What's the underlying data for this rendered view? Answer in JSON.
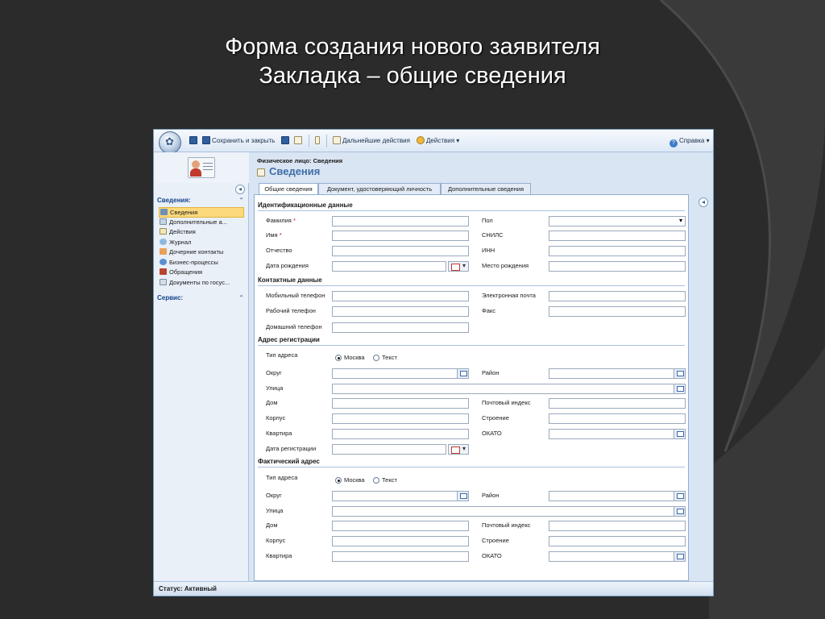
{
  "slide": {
    "title_line1": "Форма создания нового заявителя",
    "title_line2": "Закладка – общие сведения"
  },
  "toolbar": {
    "save_close": "Сохранить и закрыть",
    "further_actions": "Дальнейшие действия",
    "actions": "Действия ▾",
    "help": "Справка ▾"
  },
  "nav": {
    "section_info": "Сведения:",
    "section_service": "Сервис:",
    "items": [
      {
        "label": "Сведения",
        "icon": "info-icon",
        "selected": true
      },
      {
        "label": "Дополнительные а...",
        "icon": "address-icon"
      },
      {
        "label": "Действия",
        "icon": "actions-icon"
      },
      {
        "label": "Журнал",
        "icon": "journal-icon"
      },
      {
        "label": "Дочерние контакты",
        "icon": "contacts-icon"
      },
      {
        "label": "Бизнес-процессы",
        "icon": "process-icon"
      },
      {
        "label": "Обращения",
        "icon": "requests-icon"
      },
      {
        "label": "Документы по госус...",
        "icon": "documents-icon"
      }
    ]
  },
  "header": {
    "entity": "Физическое лицо: Сведения",
    "title": "Сведения"
  },
  "tabs": [
    {
      "label": "Общие сведения",
      "active": true
    },
    {
      "label": "Документ, удостоверяющий личность"
    },
    {
      "label": "Дополнительные сведения"
    }
  ],
  "form": {
    "sec_ident": "Идентификационные данные",
    "lastname": "Фамилия",
    "firstname": "Имя",
    "patronymic": "Отчество",
    "birthdate": "Дата рождения",
    "gender": "Пол",
    "snils": "СНИЛС",
    "inn": "ИНН",
    "birthplace": "Место рождения",
    "sec_contacts": "Контактные данные",
    "mobile": "Мобильный телефон",
    "work_phone": "Рабочий телефон",
    "home_phone": "Домашний телефон",
    "email": "Электронная почта",
    "fax": "Факс",
    "sec_reg": "Адрес регистрации",
    "sec_fact": "Фактический адрес",
    "addr_type": "Тип адреса",
    "opt_moscow": "Москва",
    "opt_text": "Текст",
    "district": "Округ",
    "region": "Район",
    "street": "Улица",
    "house": "Дом",
    "zip": "Почтовый индекс",
    "building": "Корпус",
    "structure": "Строение",
    "flat": "Квартира",
    "okato": "ОКАТО",
    "reg_date": "Дата регистрации",
    "required_mark": "*"
  },
  "status": {
    "text": "Статус: Активный"
  }
}
